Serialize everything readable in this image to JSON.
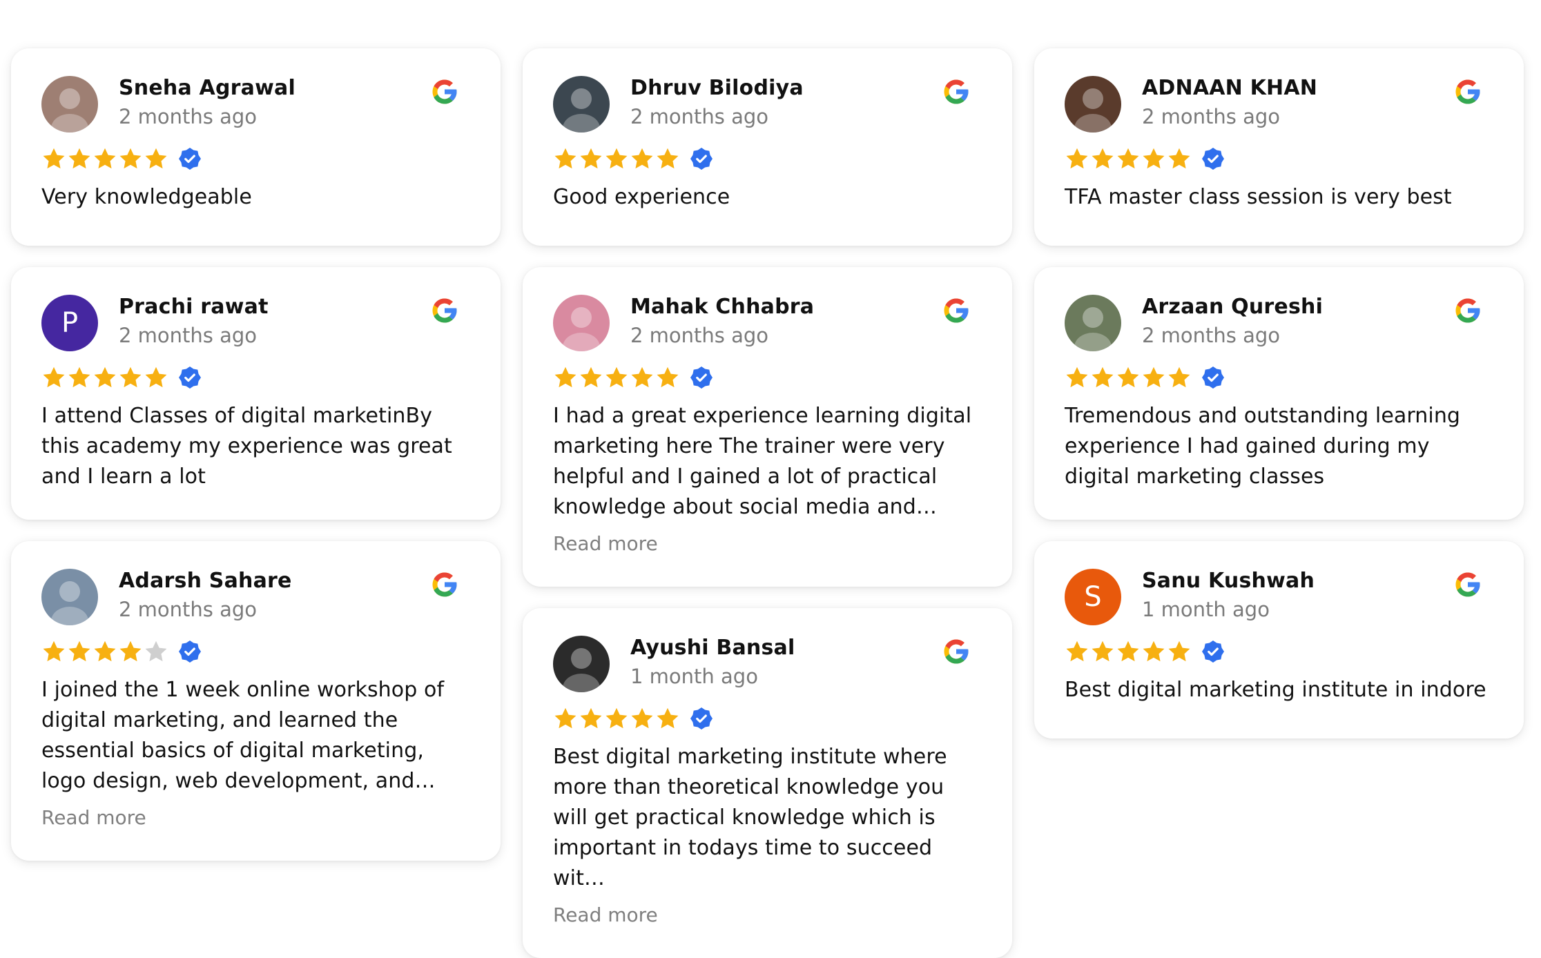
{
  "colors": {
    "star_filled": "#F7B011",
    "star_empty": "#CFCFCF",
    "verified_badge": "#2F6FED",
    "google_blue": "#4285F4",
    "google_red": "#EA4335",
    "google_yellow": "#FBBC05",
    "google_green": "#34A853"
  },
  "icons": {
    "platform": "google-g-logo",
    "verified": "verified-check-badge",
    "rating": "star"
  },
  "read_more_label": "Read more",
  "reviews": [
    {
      "name": "Sneha Agrawal",
      "time": "2 months ago",
      "rating": 5,
      "text": "Very knowledgeable",
      "avatar": "photo",
      "avatar_color": "#9e7f73",
      "avatar_letter": "",
      "read_more": false
    },
    {
      "name": "Dhruv Bilodiya",
      "time": "2 months ago",
      "rating": 5,
      "text": "Good experience",
      "avatar": "photo",
      "avatar_color": "#3c4750",
      "avatar_letter": "",
      "read_more": false
    },
    {
      "name": "ADNAAN KHAN",
      "time": "2 months ago",
      "rating": 5,
      "text": "TFA master class session is very best",
      "avatar": "photo",
      "avatar_color": "#5a3b2c",
      "avatar_letter": "",
      "read_more": false
    },
    {
      "name": "Prachi rawat",
      "time": "2 months ago",
      "rating": 5,
      "text": "I attend Classes of digital marketinBy this academy my experience was great and I learn a lot",
      "avatar": "letter",
      "avatar_color": "#4527a0",
      "avatar_letter": "P",
      "read_more": false
    },
    {
      "name": "Mahak Chhabra",
      "time": "2 months ago",
      "rating": 5,
      "text": "I had a great experience learning digital marketing here The trainer were very helpful and I gained a lot of practical knowledge about social media and…",
      "avatar": "photo",
      "avatar_color": "#d98aa0",
      "avatar_letter": "",
      "read_more": true
    },
    {
      "name": "Arzaan Qureshi",
      "time": "2 months ago",
      "rating": 5,
      "text": "Tremendous and outstanding learning experience I had gained during my digital marketing classes",
      "avatar": "photo",
      "avatar_color": "#6b7a5c",
      "avatar_letter": "",
      "read_more": false
    },
    {
      "name": "Adarsh Sahare",
      "time": "2 months ago",
      "rating": 4,
      "text": "I joined the 1 week online workshop of digital marketing, and learned the essential basics of digital marketing, logo design, web development, and…",
      "avatar": "photo",
      "avatar_color": "#7a8fa6",
      "avatar_letter": "",
      "read_more": true
    },
    {
      "name": "Ayushi Bansal",
      "time": "1 month ago",
      "rating": 5,
      "text": "Best digital marketing institute where more than theoretical knowledge you will get practical knowledge which is important in todays time to succeed wit…",
      "avatar": "photo",
      "avatar_color": "#2b2b2b",
      "avatar_letter": "",
      "read_more": true
    },
    {
      "name": "Sanu Kushwah",
      "time": "1 month ago",
      "rating": 5,
      "text": "Best digital marketing institute in indore",
      "avatar": "letter",
      "avatar_color": "#e8590c",
      "avatar_letter": "S",
      "read_more": false
    }
  ]
}
